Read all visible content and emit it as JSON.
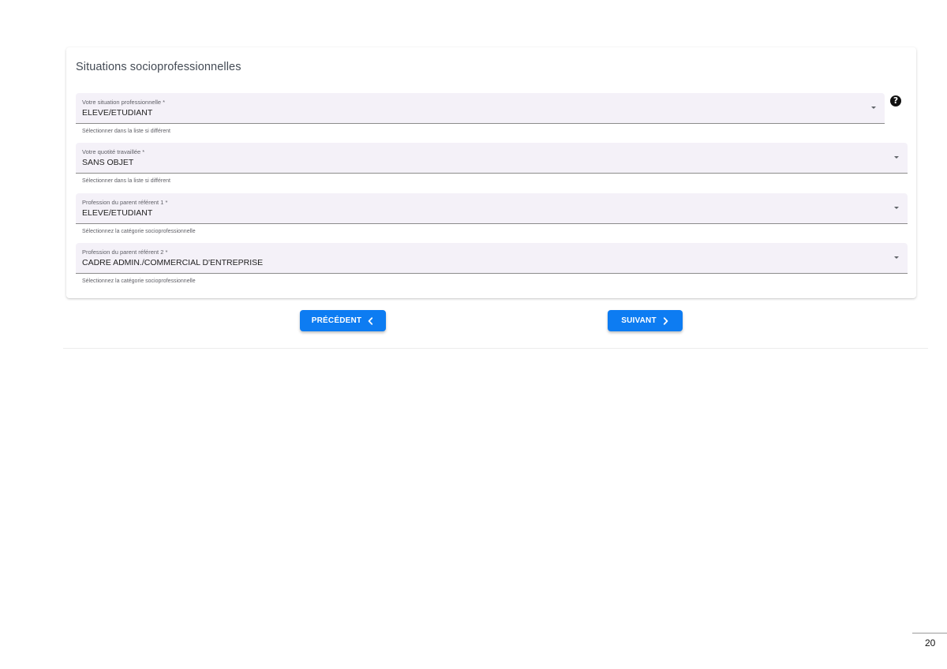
{
  "section": {
    "title": "Situations socioprofessionnelles"
  },
  "fields": [
    {
      "label": "Votre situation professionnelle *",
      "value": "ELEVE/ETUDIANT",
      "hint": "Sélectionner dans la liste si différent"
    },
    {
      "label": "Votre quotité travaillée *",
      "value": "SANS OBJET",
      "hint": "Sélectionner dans la liste si différent"
    },
    {
      "label": "Profession du parent référent 1 *",
      "value": "ELEVE/ETUDIANT",
      "hint": "Sélectionnez la catégorie socioprofessionnelle"
    },
    {
      "label": "Profession du parent référent 2 *",
      "value": "CADRE ADMIN./COMMERCIAL D'ENTREPRISE",
      "hint": "Sélectionnez la catégorie socioprofessionnelle"
    }
  ],
  "help": {
    "icon": "question-circle-icon",
    "glyph": "?"
  },
  "navigation": {
    "previous_label": "PRÉCÉDENT",
    "previous_icon": "chevron-left-icon",
    "next_label": "SUIVANT",
    "next_icon": "chevron-right-icon"
  },
  "footer": {
    "page_number": "20"
  },
  "colors": {
    "accent": "#0d7cf2",
    "field_background": "#f4f1f8"
  }
}
